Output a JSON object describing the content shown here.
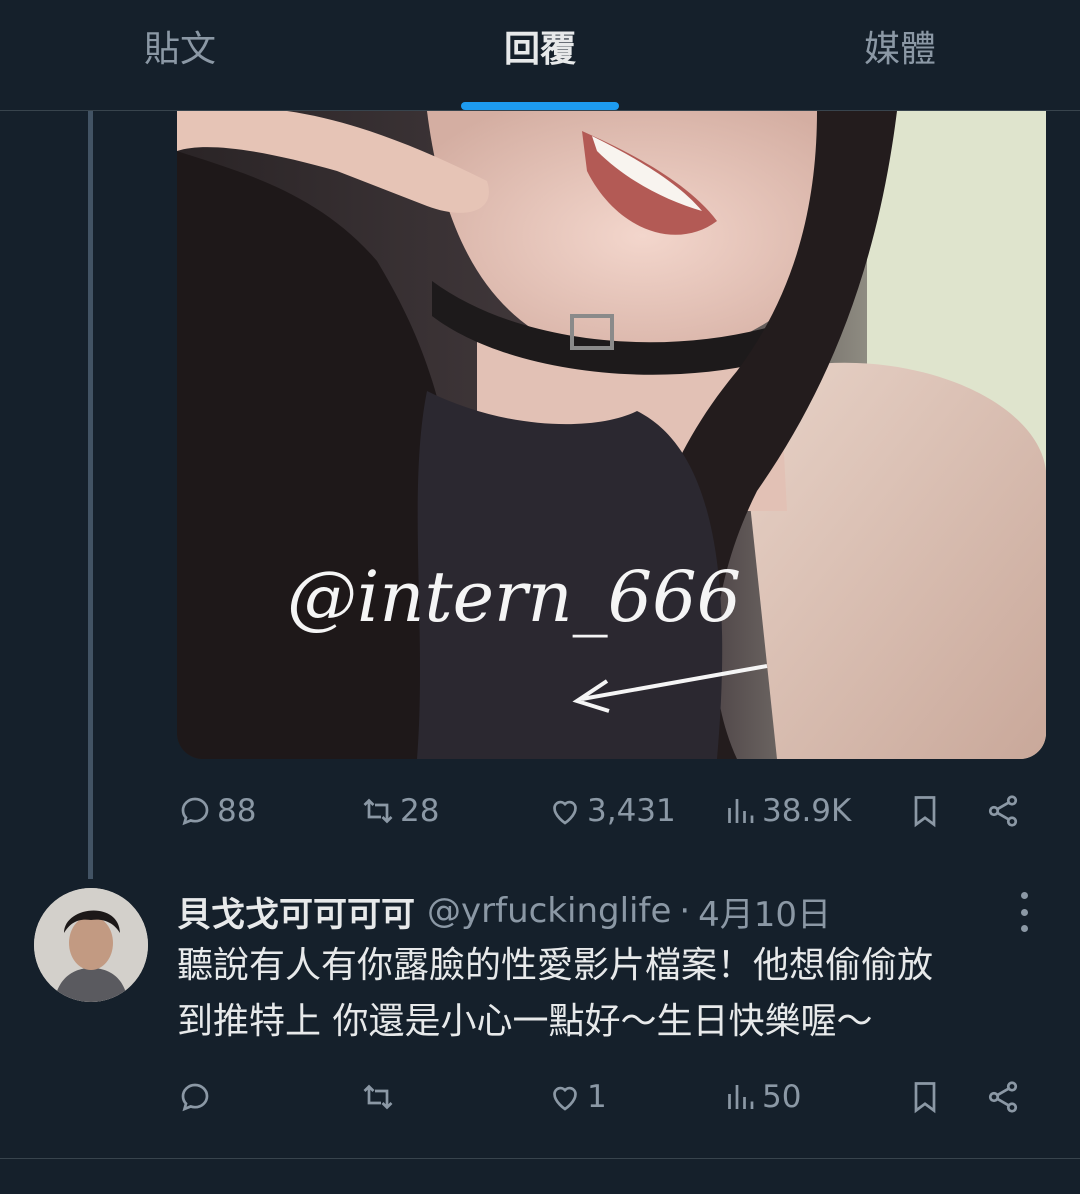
{
  "tabs": [
    {
      "label": "貼文"
    },
    {
      "label": "回覆"
    },
    {
      "label": "媒體"
    }
  ],
  "colors": {
    "background": "#15202b",
    "accent": "#1d9bf0",
    "text_primary": "#e7e9ea",
    "text_secondary": "#8b98a5",
    "border": "#38444d"
  },
  "media_post": {
    "watermark": "@intern_666",
    "stats": {
      "replies": "88",
      "reposts": "28",
      "likes": "3,431",
      "views": "38.9K"
    }
  },
  "reply": {
    "display_name": "貝戈戈可可可可",
    "handle": "@yrfuckinglife",
    "separator": "·",
    "date": "4月10日",
    "text_line1": "聽說有人有你露臉的性愛影片檔案！他想偷偷放",
    "text_line2": "到推特上 你還是小心一點好～生日快樂喔～",
    "stats": {
      "replies": "",
      "reposts": "",
      "likes": "1",
      "views": "50"
    }
  },
  "icons": {
    "reply": "reply-icon",
    "repost": "repost-icon",
    "like": "heart-icon",
    "views": "views-icon",
    "bookmark": "bookmark-icon",
    "share": "share-icon",
    "more": "more-icon"
  }
}
